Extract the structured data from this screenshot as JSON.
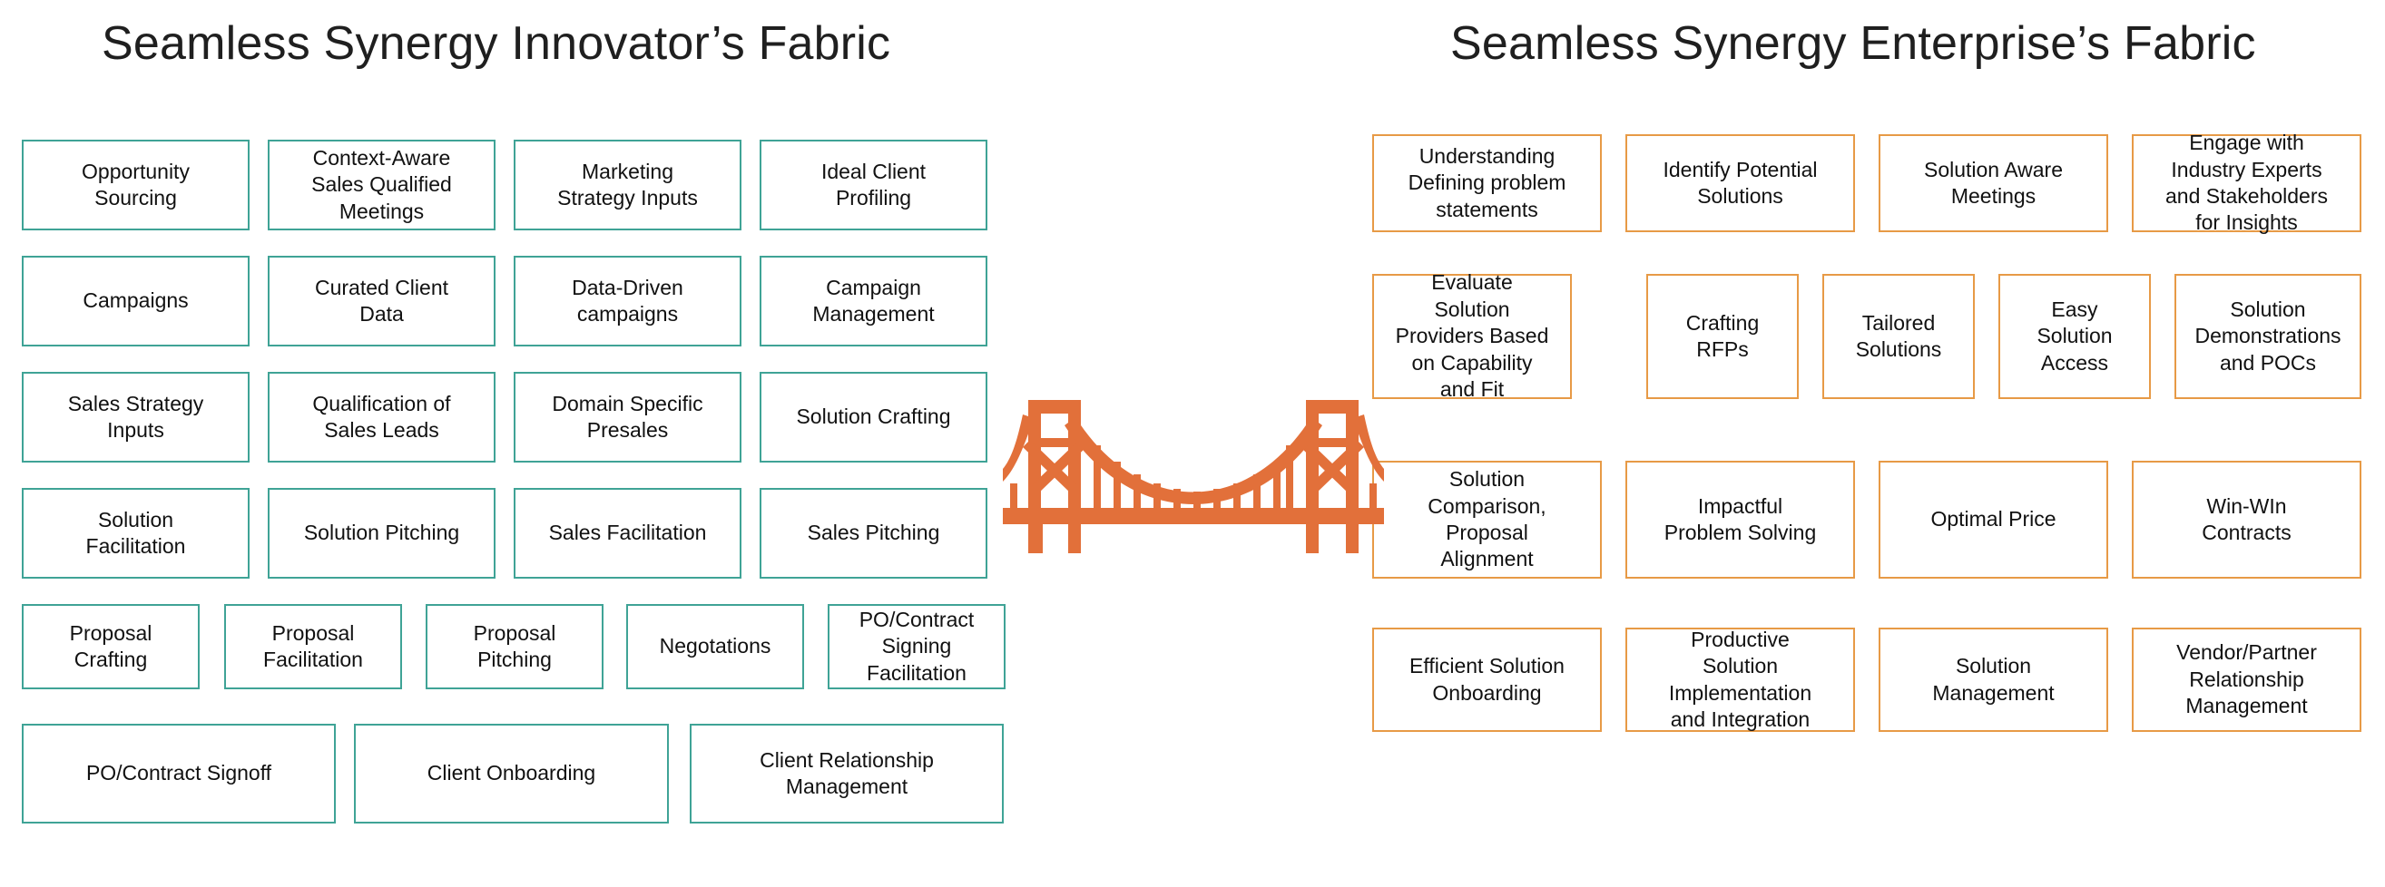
{
  "colors": {
    "teal_border": "#3FA396",
    "orange_border": "#E79A46",
    "bridge_orange": "#E2703A",
    "text": "#111111",
    "background": "#FFFFFF"
  },
  "left_panel": {
    "title": "Seamless Synergy Innovator’s Fabric",
    "accent": "#3FA396",
    "rows": [
      {
        "row_index": 0,
        "nodes": [
          "Opportunity\nSourcing",
          "Context-Aware\nSales Qualified\nMeetings",
          "Marketing\nStrategy Inputs",
          "Ideal Client\nProfiling"
        ]
      },
      {
        "row_index": 1,
        "nodes": [
          "Campaigns",
          "Curated Client\nData",
          "Data-Driven\ncampaigns",
          "Campaign\nManagement"
        ]
      },
      {
        "row_index": 2,
        "nodes": [
          "Sales Strategy\nInputs",
          "Qualification of\nSales Leads",
          "Domain Specific\nPresales",
          "Solution Crafting"
        ]
      },
      {
        "row_index": 3,
        "nodes": [
          "Solution\nFacilitation",
          "Solution Pitching",
          "Sales Facilitation",
          "Sales Pitching"
        ]
      },
      {
        "row_index": 4,
        "nodes": [
          "Proposal\nCrafting",
          "Proposal\nFacilitation",
          "Proposal\nPitching",
          "Negotations",
          "PO/Contract\nSigning\nFacilitation"
        ]
      },
      {
        "row_index": 5,
        "nodes": [
          "PO/Contract Signoff",
          "Client Onboarding",
          "Client Relationship\nManagement"
        ]
      }
    ]
  },
  "right_panel": {
    "title": "Seamless Synergy Enterprise’s Fabric",
    "accent": "#E79A46",
    "rows": [
      {
        "row_index": 0,
        "nodes": [
          "Understanding\nDefining problem\nstatements",
          "Identify Potential\nSolutions",
          "Solution Aware\nMeetings",
          "Engage with\nIndustry Experts\nand Stakeholders\nfor Insights"
        ]
      },
      {
        "row_index": 1,
        "nodes": [
          "Evaluate\nSolution\nProviders Based\non Capability\nand Fit",
          "Crafting\nRFPs",
          "Tailored\nSolutions",
          "Easy\nSolution\nAccess",
          "Solution\nDemonstrations\nand POCs"
        ]
      },
      {
        "row_index": 2,
        "nodes": [
          "Solution\nComparison,\nProposal\nAlignment",
          "Impactful\nProblem Solving",
          "Optimal Price",
          "Win-WIn\nContracts"
        ]
      },
      {
        "row_index": 3,
        "nodes": [
          "Efficient Solution\nOnboarding",
          "Productive\nSolution\nImplementation\nand Integration",
          "Solution\nManagement",
          "Vendor/Partner\nRelationship\nManagement"
        ]
      }
    ]
  },
  "center_icon": {
    "name": "suspension-bridge-icon",
    "color": "#E2703A"
  }
}
